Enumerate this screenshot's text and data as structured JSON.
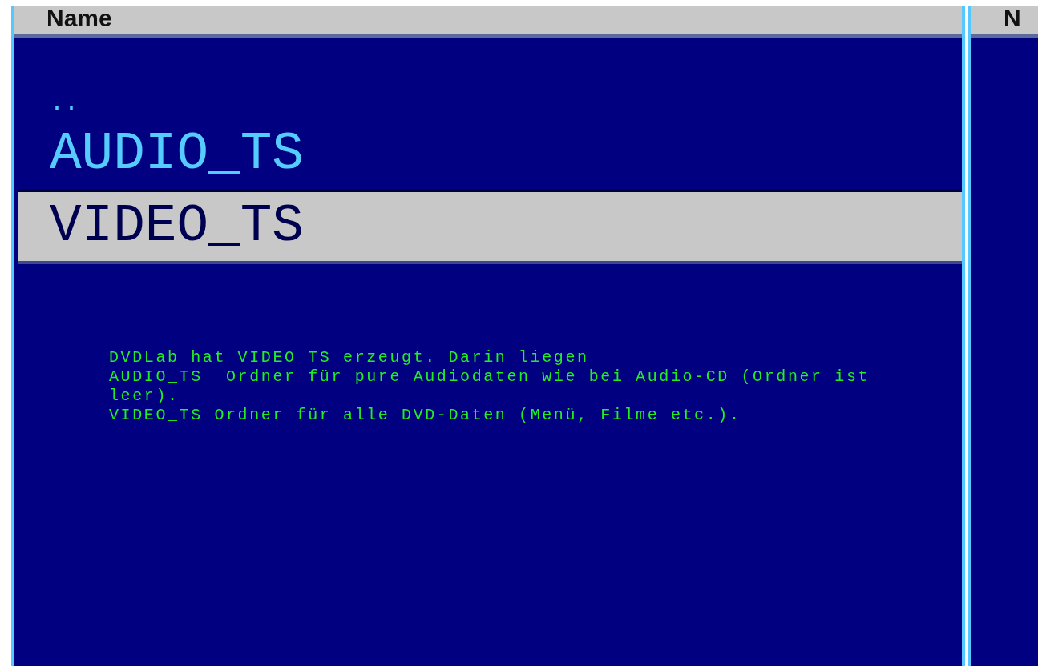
{
  "left_panel": {
    "header": {
      "column": "Name"
    },
    "files": [
      {
        "name": "..",
        "selected": false
      },
      {
        "name": "AUDIO_TS",
        "selected": false
      },
      {
        "name": "VIDEO_TS",
        "selected": true
      }
    ],
    "note": [
      "DVDLab hat VIDEO_TS erzeugt. Darin liegen",
      "AUDIO_TS  Ordner für pure Audiodaten wie bei Audio-CD (Ordner ist",
      "leer).",
      "VIDEO_TS Ordner für alle DVD-Daten (Menü, Filme etc.)."
    ]
  },
  "right_panel": {
    "header": {
      "column": "N"
    }
  }
}
